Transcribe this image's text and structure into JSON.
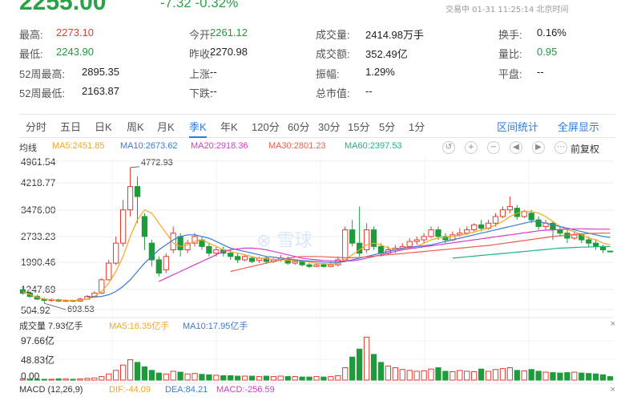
{
  "header": {
    "price": "2255.00",
    "change": "-7.32 -0.32%",
    "trade_time": "交易中 01-31 11:25:14 北京时间"
  },
  "stats": [
    {
      "label": "最高:",
      "value": "2273.10",
      "color": "red"
    },
    {
      "label": "今开:",
      "value": "2261.12",
      "color": "green"
    },
    {
      "label": "成交量:",
      "value": "2414.98万手",
      "color": ""
    },
    {
      "label": "换手:",
      "value": "0.16%",
      "color": ""
    },
    {
      "label": "最低:",
      "value": "2243.90",
      "color": "green"
    },
    {
      "label": "昨收:",
      "value": "2270.98",
      "color": ""
    },
    {
      "label": "成交额:",
      "value": "352.49亿",
      "color": ""
    },
    {
      "label": "量比:",
      "value": "0.95",
      "color": "green"
    },
    {
      "label": "52周最高:",
      "value": "2895.35",
      "color": ""
    },
    {
      "label": "上涨:",
      "value": "--",
      "color": ""
    },
    {
      "label": "振幅:",
      "value": "1.29%",
      "color": ""
    },
    {
      "label": "平盘:",
      "value": "--",
      "color": ""
    },
    {
      "label": "52周最低:",
      "value": "2163.87",
      "color": ""
    },
    {
      "label": "下跌:",
      "value": "--",
      "color": ""
    },
    {
      "label": "总市值:",
      "value": "--",
      "color": ""
    }
  ],
  "tabs": [
    "分时",
    "五日",
    "日K",
    "周K",
    "月K",
    "季K",
    "年K",
    "120分",
    "60分",
    "30分",
    "15分",
    "5分",
    "1分"
  ],
  "active_tab": "季K",
  "tab_links": [
    "区间统计",
    "全屏显示"
  ],
  "ma_legend": {
    "title": "均线",
    "items": [
      {
        "label": "MA5:2451.85",
        "color": "#f5a623"
      },
      {
        "label": "MA10:2673.62",
        "color": "#3a7bd5"
      },
      {
        "label": "MA20:2918.36",
        "color": "#d63cc6"
      },
      {
        "label": "MA30:2801.23",
        "color": "#ec5f4e"
      },
      {
        "label": "MA60:2397.53",
        "color": "#1fb28d"
      }
    ]
  },
  "controls": {
    "undo": "↺",
    "zoom_in": "+",
    "zoom_out": "−",
    "left": "◀",
    "right": "▶",
    "fuquan": "前复权"
  },
  "watermark": "雪球",
  "chart_data": {
    "type": "candlestick",
    "y_ticks": [
      "4961.54",
      "4218.77",
      "3476.00",
      "2733.23",
      "1990.46",
      "1247.69",
      "504.92"
    ],
    "ylim": [
      504.92,
      4961.54
    ],
    "annotations": {
      "max": "4772.93",
      "min": "693.53"
    },
    "colors": {
      "up": "#e63a2e",
      "down": "#1f9b3c"
    },
    "candles": [
      [
        1100,
        1000,
        1150,
        950
      ],
      [
        1000,
        900,
        1050,
        860
      ],
      [
        900,
        820,
        950,
        790
      ],
      [
        820,
        780,
        860,
        693.53
      ],
      [
        780,
        800,
        840,
        740
      ],
      [
        800,
        760,
        830,
        730
      ],
      [
        760,
        780,
        810,
        740
      ],
      [
        780,
        760,
        800,
        730
      ],
      [
        760,
        820,
        860,
        740
      ],
      [
        820,
        900,
        940,
        800
      ],
      [
        900,
        1000,
        1050,
        880
      ],
      [
        1000,
        1400,
        1450,
        980
      ],
      [
        1400,
        1900,
        2000,
        1380
      ],
      [
        1900,
        2500,
        2700,
        1850
      ],
      [
        2500,
        3500,
        3800,
        2400
      ],
      [
        3500,
        4200,
        4772.93,
        3300
      ],
      [
        4200,
        3900,
        4500,
        3100
      ],
      [
        3300,
        2700,
        3400,
        2300
      ],
      [
        2500,
        2000,
        2600,
        1800
      ],
      [
        2000,
        1600,
        2100,
        1500
      ],
      [
        1700,
        2100,
        2200,
        1600
      ],
      [
        2300,
        2800,
        3000,
        2200
      ],
      [
        2700,
        2300,
        2800,
        2100
      ],
      [
        2300,
        2500,
        2600,
        2200
      ],
      [
        2500,
        2700,
        2800,
        2400
      ],
      [
        2600,
        2400,
        2700,
        2300
      ],
      [
        2400,
        2200,
        2500,
        2100
      ],
      [
        2200,
        2300,
        2400,
        2100
      ],
      [
        2300,
        2200,
        2400,
        2100
      ],
      [
        2200,
        2100,
        2300,
        2000
      ],
      [
        2100,
        2000,
        2200,
        1900
      ],
      [
        2000,
        2100,
        2150,
        1950
      ],
      [
        2050,
        1950,
        2100,
        1900
      ],
      [
        1980,
        2050,
        2100,
        1900
      ],
      [
        2050,
        1950,
        2100,
        1880
      ],
      [
        1950,
        2000,
        2050,
        1900
      ],
      [
        2000,
        2050,
        2150,
        1950
      ],
      [
        2000,
        1900,
        2100,
        1850
      ],
      [
        1900,
        1950,
        2000,
        1850
      ],
      [
        1950,
        1850,
        2000,
        1800
      ],
      [
        1850,
        1800,
        1900,
        1750
      ],
      [
        1800,
        1850,
        1900,
        1780
      ],
      [
        1850,
        1800,
        1900,
        1760
      ],
      [
        1800,
        1850,
        1950,
        1780
      ],
      [
        1850,
        2000,
        2100,
        1800
      ],
      [
        2000,
        2900,
        3000,
        1950
      ],
      [
        2900,
        2500,
        3200,
        2400
      ],
      [
        2500,
        2200,
        3600,
        2100
      ],
      [
        2300,
        2900,
        3100,
        2200
      ],
      [
        2900,
        2400,
        3000,
        2300
      ],
      [
        2400,
        2200,
        2500,
        2100
      ],
      [
        2200,
        2300,
        2400,
        2150
      ],
      [
        2300,
        2350,
        2450,
        2200
      ],
      [
        2350,
        2400,
        2500,
        2300
      ],
      [
        2400,
        2550,
        2650,
        2350
      ],
      [
        2550,
        2600,
        2700,
        2450
      ],
      [
        2600,
        2700,
        2800,
        2500
      ],
      [
        2700,
        2900,
        3000,
        2650
      ],
      [
        2900,
        2700,
        3000,
        2600
      ],
      [
        2700,
        2600,
        2800,
        2500
      ],
      [
        2600,
        2750,
        2850,
        2550
      ],
      [
        2750,
        2800,
        2950,
        2700
      ],
      [
        2800,
        2900,
        3000,
        2750
      ],
      [
        2900,
        3050,
        3100,
        2850
      ],
      [
        3050,
        2950,
        3200,
        2850
      ],
      [
        2950,
        3100,
        3200,
        2900
      ],
      [
        3100,
        3300,
        3400,
        3000
      ],
      [
        3300,
        3500,
        3600,
        3250
      ],
      [
        3500,
        3600,
        3900,
        3400
      ],
      [
        3550,
        3300,
        3650,
        3200
      ],
      [
        3300,
        3450,
        3500,
        3250
      ],
      [
        3400,
        3200,
        3500,
        3100
      ],
      [
        3200,
        3000,
        3300,
        2900
      ],
      [
        3000,
        3100,
        3200,
        2900
      ],
      [
        3100,
        2900,
        3150,
        2600
      ],
      [
        2900,
        2800,
        3000,
        2700
      ],
      [
        2800,
        2650,
        2900,
        2500
      ],
      [
        2650,
        2750,
        2850,
        2600
      ],
      [
        2750,
        2600,
        2800,
        2500
      ],
      [
        2600,
        2500,
        2700,
        2400
      ],
      [
        2500,
        2400,
        2600,
        2300
      ],
      [
        2400,
        2300,
        2450,
        2200
      ],
      [
        2261.12,
        2255,
        2273.1,
        2243.9
      ]
    ],
    "ma_series": [
      {
        "name": "MA5",
        "color": "#f5a623",
        "values": [
          1050,
          950,
          880,
          820,
          800,
          790,
          785,
          780,
          790,
          820,
          900,
          1050,
          1300,
          1650,
          2100,
          2700,
          3200,
          3500,
          3400,
          3100,
          2800,
          2500,
          2400,
          2450,
          2550,
          2600,
          2500,
          2400,
          2300,
          2250,
          2200,
          2150,
          2100,
          2050,
          2030,
          2010,
          2000,
          1990,
          1980,
          1960,
          1930,
          1900,
          1880,
          1870,
          1890,
          2000,
          2150,
          2300,
          2450,
          2500,
          2450,
          2350,
          2300,
          2300,
          2350,
          2400,
          2500,
          2600,
          2650,
          2680,
          2700,
          2730,
          2780,
          2830,
          2900,
          2950,
          3050,
          3150,
          3300,
          3400,
          3450,
          3450,
          3400,
          3300,
          3150,
          3000,
          2900,
          2850,
          2750,
          2650,
          2600,
          2500,
          2451.85
        ]
      },
      {
        "name": "MA10",
        "color": "#3a7bd5",
        "values": [
          null,
          null,
          null,
          null,
          null,
          null,
          null,
          null,
          null,
          880,
          880,
          900,
          950,
          1050,
          1200,
          1400,
          1650,
          1900,
          2100,
          2300,
          2450,
          2600,
          2700,
          2750,
          2750,
          2700,
          2650,
          2550,
          2450,
          2350,
          2300,
          2250,
          2200,
          2150,
          2100,
          2080,
          2050,
          2030,
          2000,
          1980,
          1960,
          1950,
          1930,
          1920,
          1920,
          1950,
          2000,
          2050,
          2100,
          2150,
          2200,
          2250,
          2300,
          2350,
          2380,
          2400,
          2420,
          2450,
          2500,
          2550,
          2600,
          2650,
          2700,
          2750,
          2800,
          2850,
          2900,
          2950,
          3000,
          3050,
          3100,
          3150,
          3150,
          3100,
          3050,
          3000,
          2950,
          2900,
          2850,
          2800,
          2750,
          2700,
          2673.62
        ]
      },
      {
        "name": "MA20",
        "color": "#d63cc6",
        "values": [
          null,
          null,
          null,
          null,
          null,
          null,
          null,
          null,
          null,
          null,
          null,
          null,
          null,
          null,
          null,
          null,
          null,
          null,
          null,
          1350,
          1450,
          1550,
          1650,
          1750,
          1850,
          1950,
          2050,
          2150,
          2250,
          2300,
          2330,
          2350,
          2350,
          2330,
          2300,
          2250,
          2200,
          2150,
          2100,
          2050,
          2020,
          2000,
          1980,
          1970,
          1960,
          1960,
          1970,
          2000,
          2050,
          2100,
          2150,
          2200,
          2250,
          2300,
          2330,
          2360,
          2390,
          2420,
          2450,
          2480,
          2510,
          2540,
          2570,
          2600,
          2630,
          2660,
          2690,
          2720,
          2750,
          2780,
          2810,
          2840,
          2870,
          2890,
          2900,
          2910,
          2920,
          2930,
          2930,
          2925,
          2920,
          2918,
          2918.36
        ]
      },
      {
        "name": "MA30",
        "color": "#ec5f4e",
        "values": [
          null,
          null,
          null,
          null,
          null,
          null,
          null,
          null,
          null,
          null,
          null,
          null,
          null,
          null,
          null,
          null,
          null,
          null,
          null,
          null,
          null,
          null,
          null,
          null,
          null,
          null,
          null,
          null,
          null,
          1650,
          1700,
          1750,
          1800,
          1850,
          1900,
          1950,
          2000,
          2050,
          2080,
          2100,
          2100,
          2100,
          2090,
          2080,
          2070,
          2060,
          2060,
          2070,
          2090,
          2110,
          2130,
          2150,
          2170,
          2190,
          2210,
          2230,
          2250,
          2270,
          2290,
          2310,
          2330,
          2350,
          2370,
          2390,
          2410,
          2430,
          2460,
          2490,
          2520,
          2550,
          2580,
          2610,
          2640,
          2670,
          2700,
          2720,
          2740,
          2760,
          2780,
          2790,
          2795,
          2800,
          2801.23
        ]
      },
      {
        "name": "MA60",
        "color": "#1fb28d",
        "values": [
          null,
          null,
          null,
          null,
          null,
          null,
          null,
          null,
          null,
          null,
          null,
          null,
          null,
          null,
          null,
          null,
          null,
          null,
          null,
          null,
          null,
          null,
          null,
          null,
          null,
          null,
          null,
          null,
          null,
          null,
          null,
          null,
          null,
          null,
          null,
          null,
          null,
          null,
          null,
          null,
          null,
          null,
          null,
          null,
          null,
          null,
          null,
          null,
          null,
          null,
          null,
          null,
          null,
          null,
          null,
          null,
          null,
          null,
          null,
          null,
          2050,
          2070,
          2090,
          2110,
          2130,
          2150,
          2170,
          2190,
          2210,
          2230,
          2250,
          2270,
          2290,
          2310,
          2330,
          2350,
          2360,
          2370,
          2380,
          2385,
          2390,
          2395,
          2397.53
        ]
      }
    ],
    "volume": {
      "title": "成交量 7.93亿手",
      "ma": [
        {
          "label": "MA5:16.35亿手",
          "color": "#f5a623"
        },
        {
          "label": "MA10:17.95亿手",
          "color": "#3a7bd5"
        }
      ],
      "y_ticks": [
        "97.66亿",
        "48.83亿",
        "0.00"
      ],
      "ylim": [
        0,
        97.66
      ],
      "values": [
        3,
        2,
        2,
        2,
        2,
        3,
        3,
        2,
        3,
        4,
        5,
        8,
        14,
        22,
        34,
        46,
        40,
        30,
        22,
        16,
        14,
        20,
        18,
        14,
        15,
        13,
        12,
        11,
        10,
        10,
        9,
        9,
        9,
        8,
        9,
        8,
        9,
        8,
        8,
        7,
        7,
        8,
        7,
        8,
        10,
        28,
        52,
        70,
        97,
        58,
        40,
        32,
        28,
        24,
        22,
        20,
        21,
        25,
        28,
        20,
        19,
        22,
        20,
        19,
        25,
        20,
        24,
        26,
        28,
        22,
        21,
        24,
        20,
        18,
        17,
        16,
        17,
        18,
        16,
        15,
        14,
        12,
        7.93
      ],
      "up": [
        1,
        0,
        0,
        0,
        1,
        0,
        1,
        0,
        1,
        1,
        1,
        1,
        1,
        1,
        1,
        1,
        0,
        0,
        0,
        0,
        1,
        1,
        0,
        1,
        1,
        0,
        0,
        1,
        0,
        0,
        0,
        1,
        0,
        1,
        0,
        1,
        1,
        0,
        1,
        0,
        0,
        1,
        0,
        1,
        1,
        1,
        0,
        0,
        1,
        0,
        0,
        1,
        1,
        1,
        1,
        1,
        1,
        1,
        0,
        0,
        1,
        1,
        1,
        1,
        0,
        1,
        1,
        1,
        1,
        0,
        1,
        0,
        0,
        1,
        0,
        0,
        0,
        1,
        0,
        0,
        0,
        0,
        0
      ]
    },
    "macd": {
      "title": "MACD (12,26,9)",
      "dif": "DIF:-44.09",
      "dea": "DEA:84.21",
      "macd": "MACD:-256.59",
      "colors": {
        "dif": "#f5a623",
        "dea": "#3a7bd5",
        "macd": "#d63cc6"
      }
    }
  }
}
